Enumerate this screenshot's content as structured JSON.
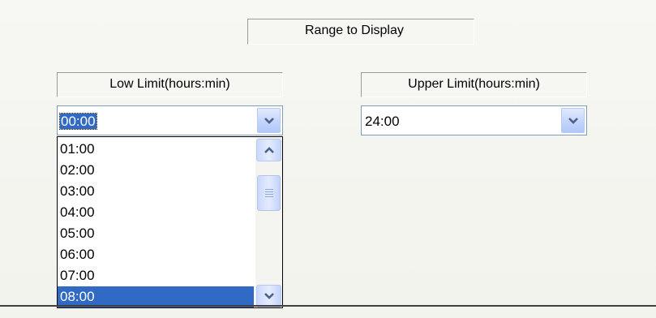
{
  "range_section": {
    "title": "Range to Display"
  },
  "low_limit": {
    "label": "Low Limit(hours:min)",
    "value": "00:00",
    "list": {
      "items": [
        "01:00",
        "02:00",
        "03:00",
        "04:00",
        "05:00",
        "06:00",
        "07:00",
        "08:00"
      ],
      "selected": "08:00"
    }
  },
  "upper_limit": {
    "label": "Upper Limit(hours:min)",
    "value": "24:00"
  },
  "icons": {
    "dropdown": "chevron-down-icon",
    "scroll_up": "chevron-up-icon",
    "scroll_down": "chevron-down-icon",
    "thumb": "grip-icon"
  },
  "colors": {
    "selection": "#316ac5",
    "combo_border": "#7f9db9",
    "button_face": "#c6d6fd",
    "chevron": "#4d6185"
  }
}
